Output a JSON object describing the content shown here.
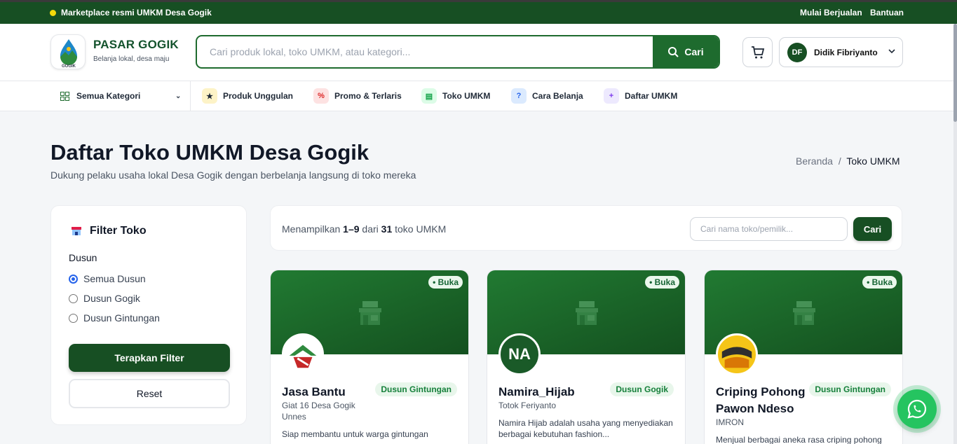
{
  "topbar": {
    "announcement": "Marketplace resmi UMKM Desa Gogik",
    "sell_link": "Mulai Berjualan",
    "help_link": "Bantuan"
  },
  "header": {
    "logo_text": "GOGIK",
    "brand": "PASAR GOGIK",
    "tagline": "Belanja lokal, desa maju",
    "search_placeholder": "Cari produk lokal, toko UMKM, atau kategori...",
    "search_button": "Cari",
    "user_initials": "DF",
    "user_name": "Didik Fibriyanto"
  },
  "nav": {
    "all_categories": "Semua Kategori",
    "items": [
      {
        "label": "Produk Unggulan",
        "icon": "star-icon",
        "glyph": "★",
        "bg": "#fdf3c7"
      },
      {
        "label": "Promo & Terlaris",
        "icon": "percent-icon",
        "glyph": "%",
        "bg": "#fde2e2"
      },
      {
        "label": "Toko UMKM",
        "icon": "store-icon",
        "glyph": "▤",
        "bg": "#dcfce7"
      },
      {
        "label": "Cara Belanja",
        "icon": "question-icon",
        "glyph": "?",
        "bg": "#dbeafe"
      },
      {
        "label": "Daftar UMKM",
        "icon": "plus-icon",
        "glyph": "+",
        "bg": "#ede9fe"
      }
    ]
  },
  "page": {
    "title": "Daftar Toko UMKM Desa Gogik",
    "subtitle": "Dukung pelaku usaha lokal Desa Gogik dengan berbelanja langsung di toko mereka",
    "breadcrumb_home": "Beranda",
    "breadcrumb_sep": "/",
    "breadcrumb_current": "Toko UMKM"
  },
  "filter": {
    "title": "Filter Toko",
    "dusun_label": "Dusun",
    "options": [
      "Semua Dusun",
      "Dusun Gogik",
      "Dusun Gintungan"
    ],
    "selected": "Semua Dusun",
    "apply_button": "Terapkan Filter",
    "reset_button": "Reset"
  },
  "results": {
    "prefix": "Menampilkan",
    "range": "1–9",
    "of": "dari",
    "total": "31",
    "suffix": "toko UMKM",
    "search_placeholder": "Cari nama toko/pemilik...",
    "search_button": "Cari"
  },
  "shops": [
    {
      "name_line1": "Jasa Bantu",
      "name_line2": "",
      "status": "• Buka",
      "dusun": "Dusun Gintungan",
      "owner": "Giat 16 Desa Gogik",
      "owner2": "Unnes",
      "description": "Siap membantu untuk warga gintungan",
      "logo_text": ""
    },
    {
      "name_line1": "Namira_Hijab",
      "name_line2": "",
      "status": "• Buka",
      "dusun": "Dusun Gogik",
      "owner": "Totok Feriyanto",
      "owner2": "",
      "description": "Namira Hijab adalah usaha yang menyediakan berbagai kebutuhan fashion...",
      "logo_text": "NA"
    },
    {
      "name_line1": "Criping Pohong",
      "name_line2": "Pawon Ndeso",
      "status": "• Buka",
      "dusun": "Dusun Gintungan",
      "owner": "IMRON",
      "owner2": "",
      "description": "Menjual berbagai aneka rasa criping pohong",
      "logo_text": "CRIPING POHONG PAWON"
    }
  ],
  "colors": {
    "primary": "#174f23",
    "accent": "#1e6b2e",
    "whatsapp": "#25c460"
  }
}
